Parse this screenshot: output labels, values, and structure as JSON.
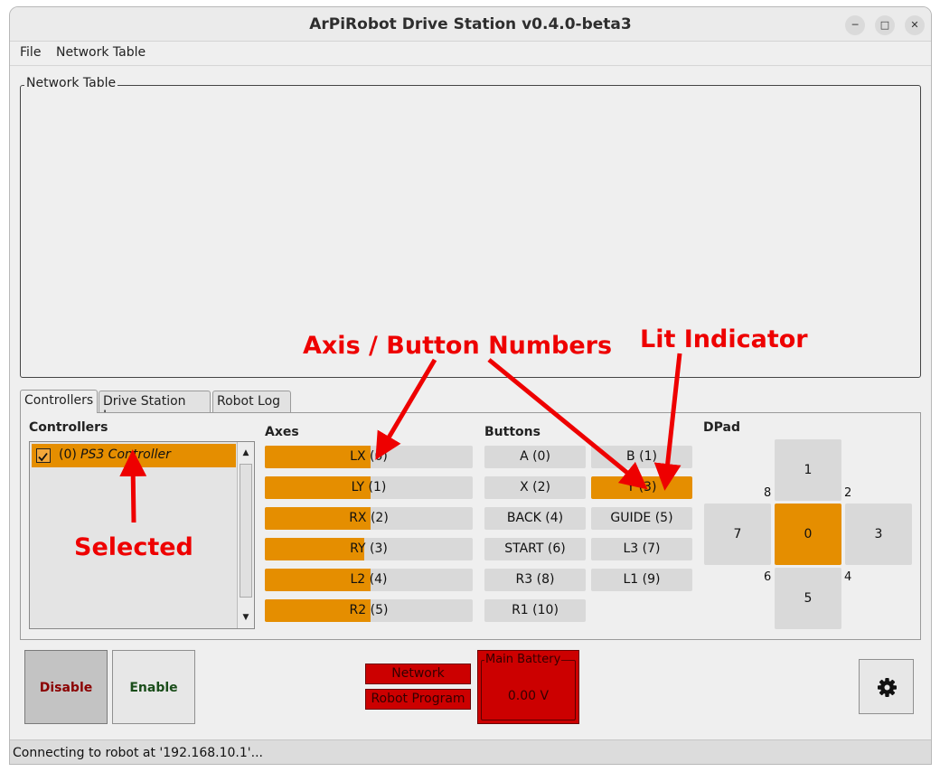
{
  "window": {
    "title": "ArPiRobot Drive Station v0.4.0-beta3"
  },
  "menu": [
    "File",
    "Network Table"
  ],
  "network_table": {
    "label": "Network Table"
  },
  "tabs": [
    {
      "label": "Controllers",
      "active": true
    },
    {
      "label": "Drive Station Log",
      "active": false
    },
    {
      "label": "Robot Log",
      "active": false
    }
  ],
  "controllers": {
    "heading": "Controllers",
    "items": [
      {
        "index": "(0)",
        "name": "PS3 Controller",
        "checked": true,
        "selected": true
      }
    ]
  },
  "axes": {
    "heading": "Axes",
    "items": [
      {
        "label": "LX (0)",
        "value": 0.51
      },
      {
        "label": "LY (1)",
        "value": 0.51
      },
      {
        "label": "RX (2)",
        "value": 0.51
      },
      {
        "label": "RY (3)",
        "value": 0.48
      },
      {
        "label": "L2 (4)",
        "value": 0.51
      },
      {
        "label": "R2 (5)",
        "value": 0.51
      }
    ]
  },
  "buttons": {
    "heading": "Buttons",
    "items": [
      {
        "label": "A (0)",
        "lit": false
      },
      {
        "label": "B (1)",
        "lit": false
      },
      {
        "label": "X (2)",
        "lit": false
      },
      {
        "label": "Y (3)",
        "lit": true
      },
      {
        "label": "BACK (4)",
        "lit": false
      },
      {
        "label": "GUIDE (5)",
        "lit": false
      },
      {
        "label": "START (6)",
        "lit": false
      },
      {
        "label": "L3 (7)",
        "lit": false
      },
      {
        "label": "R3 (8)",
        "lit": false
      },
      {
        "label": "L1 (9)",
        "lit": false
      },
      {
        "label": "R1 (10)",
        "lit": false
      }
    ]
  },
  "dpad": {
    "heading": "DPad",
    "cells": {
      "up": "1",
      "left": "7",
      "center": "0",
      "right": "3",
      "down": "5"
    },
    "corners": {
      "tl": "8",
      "tr": "2",
      "bl": "6",
      "br": "4"
    },
    "lit": "center"
  },
  "controls": {
    "disable_label": "Disable",
    "enable_label": "Enable",
    "disable_color": "#8b0000",
    "enable_color": "#1a4d1a"
  },
  "indicators": {
    "network": "Network",
    "robot_program": "Robot Program",
    "color": "#cc0000"
  },
  "battery": {
    "label": "Main Battery",
    "value": "0.00 V"
  },
  "settings": {
    "icon": "gear-icon"
  },
  "status": {
    "text": "Connecting to robot at '192.168.10.1'..."
  },
  "annotations": {
    "axis_button_numbers": "Axis / Button Numbers",
    "lit_indicator": "Lit Indicator",
    "selected": "Selected",
    "color": "#ee0000"
  },
  "colors": {
    "accent": "#e58e00",
    "inactive": "#d9d9d9",
    "error": "#cc0000"
  }
}
